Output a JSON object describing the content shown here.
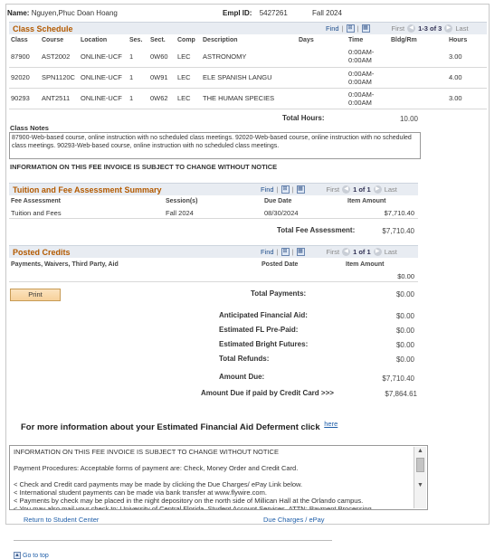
{
  "header": {
    "name_label": "Name:",
    "name_value": "Nguyen,Phuc Doan Hoang",
    "empl_label": "Empl ID:",
    "empl_value": "5427261",
    "term": "Fall 2024"
  },
  "class_schedule": {
    "title": "Class Schedule",
    "nav": {
      "find": "Find",
      "sep": "|",
      "first": "First",
      "range": "1-3 of 3",
      "last": "Last"
    },
    "columns": [
      "Class",
      "Course",
      "Location",
      "Ses.",
      "Sect.",
      "Comp",
      "Description",
      "Days",
      "Time",
      "Bldg/Rm",
      "Hours"
    ],
    "rows": [
      {
        "class": "87900",
        "course": "AST2002",
        "location": "ONLINE-UCF",
        "ses": "1",
        "sect": "0W60",
        "comp": "LEC",
        "desc": "ASTRONOMY",
        "days": "",
        "time1": "0:00AM-",
        "time2": "0:00AM",
        "bldg": "",
        "hours": "3.00"
      },
      {
        "class": "92020",
        "course": "SPN1120C",
        "location": "ONLINE-UCF",
        "ses": "1",
        "sect": "0W91",
        "comp": "LEC",
        "desc": "ELE SPANISH LANGU",
        "days": "",
        "time1": "0:00AM-",
        "time2": "0:00AM",
        "bldg": "",
        "hours": "4.00"
      },
      {
        "class": "90293",
        "course": "ANT2511",
        "location": "ONLINE-UCF",
        "ses": "1",
        "sect": "0W62",
        "comp": "LEC",
        "desc": "THE HUMAN SPECIES",
        "days": "",
        "time1": "0:00AM-",
        "time2": "0:00AM",
        "bldg": "",
        "hours": "3.00"
      }
    ],
    "total_hours_label": "Total Hours:",
    "total_hours_value": "10.00"
  },
  "class_notes": {
    "label": "Class Notes",
    "text": "87900-Web-based course, online instruction with no scheduled class meetings. 92020-Web-based course, online instruction with no scheduled class meetings. 90293-Web-based course, online instruction with no scheduled class meetings."
  },
  "notice": "INFORMATION ON THIS FEE INVOICE IS SUBJECT TO CHANGE WITHOUT NOTICE",
  "tuition": {
    "title": "Tuition and Fee Assessment Summary",
    "nav": {
      "find": "Find",
      "first": "First",
      "range": "1 of 1",
      "last": "Last"
    },
    "columns": [
      "Fee Assessment",
      "Session(s)",
      "Due Date",
      "Item Amount"
    ],
    "rows": [
      {
        "fee": "Tuition and Fees",
        "session": "Fall 2024",
        "due": "08/30/2024",
        "amount": "$7,710.40"
      }
    ],
    "total_label": "Total Fee Assessment:",
    "total_value": "$7,710.40"
  },
  "credits": {
    "title": "Posted Credits",
    "nav": {
      "find": "Find",
      "first": "First",
      "range": "1 of 1",
      "last": "Last"
    },
    "columns": [
      "Payments, Waivers, Third Party, Aid",
      "Posted Date",
      "Item Amount"
    ],
    "row_amount": "$0.00"
  },
  "print_button": "Print",
  "summary": {
    "total_payments_label": "Total Payments:",
    "total_payments_value": "$0.00",
    "anticipated_label": "Anticipated Financial Aid:",
    "anticipated_value": "$0.00",
    "fl_prepaid_label": "Estimated FL Pre-Paid:",
    "fl_prepaid_value": "$0.00",
    "bright_label": "Estimated Bright Futures:",
    "bright_value": "$0.00",
    "refunds_label": "Total Refunds:",
    "refunds_value": "$0.00",
    "amount_due_label": "Amount Due:",
    "amount_due_value": "$7,710.40",
    "credit_label": "Amount Due if paid by Credit Card >>>",
    "credit_value": "$7,864.61"
  },
  "deferment": {
    "text": "For more information about your Estimated Financial Aid Deferment click",
    "link": "here"
  },
  "info_box": {
    "lines": [
      "INFORMATION ON THIS FEE INVOICE IS SUBJECT TO CHANGE WITHOUT NOTICE",
      "",
      "Payment Procedures: Acceptable forms of payment are: Check, Money Order and Credit Card.",
      "",
      "< Check and Credit card payments may be made by clicking the Due Charges/ ePay Link below.",
      "< International student payments can be made via bank transfer at www.flywire.com.",
      "< Payments by check may be placed in the night depository on the north side of Millican Hall at the Orlando campus.",
      "< You may also mail your check to: University of Central Florida, Student Account Services, ATTN: Payment Processing"
    ]
  },
  "footer": {
    "return_link": "Return to Student Center",
    "due_link": "Due Charges / ePay",
    "goto_top": "Go to top"
  }
}
